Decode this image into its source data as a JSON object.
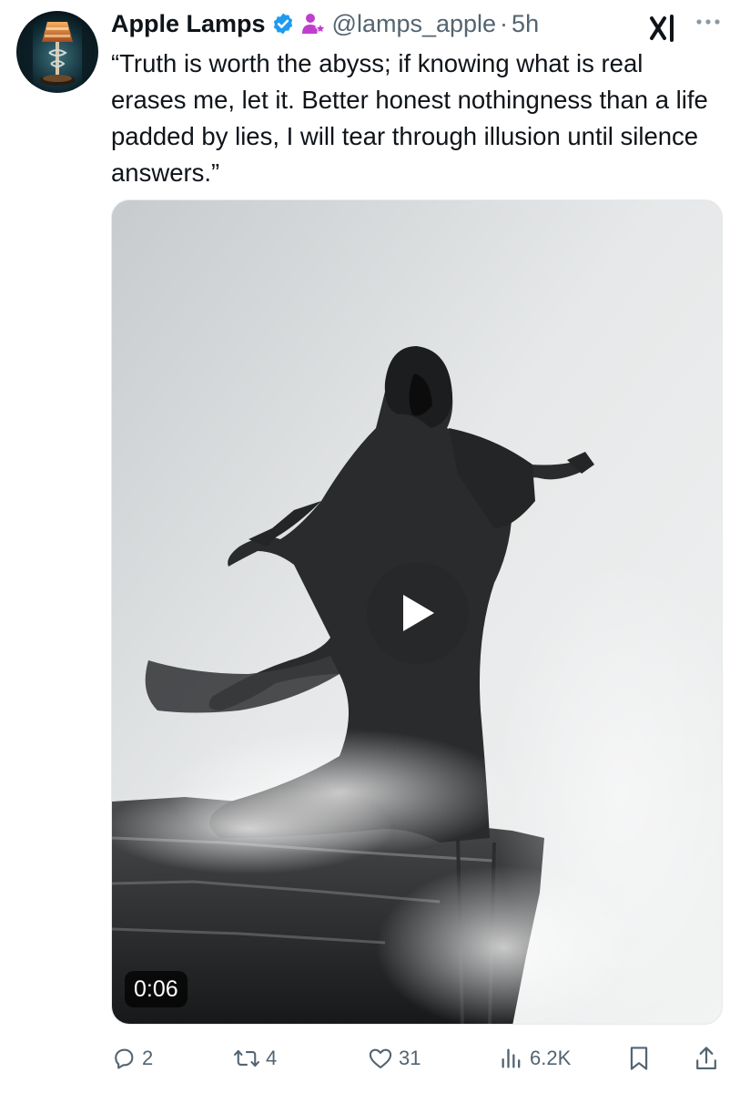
{
  "tweet": {
    "author": {
      "display_name": "Apple Lamps",
      "handle": "@lamps_apple",
      "verified": true,
      "affiliate_badge_icon": "person-star-icon"
    },
    "separator": "·",
    "time": "5h",
    "text": "“Truth is worth the abyss; if knowing what is real erases me, let it. Better honest nothingness than a life padded by lies, I will tear through illusion until silence answers.”",
    "media": {
      "type": "video",
      "duration": "0:06",
      "play_icon": "play-icon"
    },
    "metrics": {
      "replies": "2",
      "reposts": "4",
      "likes": "31",
      "views": "6.2K"
    }
  },
  "colors": {
    "text_primary": "#0f1419",
    "text_secondary": "#536471",
    "verified_blue": "#1d9bf0",
    "affiliate_purple": "#c03dcd"
  },
  "icons": {
    "grok": "grok-icon",
    "more": "more-icon",
    "reply": "reply-icon",
    "repost": "repost-icon",
    "like": "heart-icon",
    "views": "views-icon",
    "bookmark": "bookmark-icon",
    "share": "share-icon"
  }
}
